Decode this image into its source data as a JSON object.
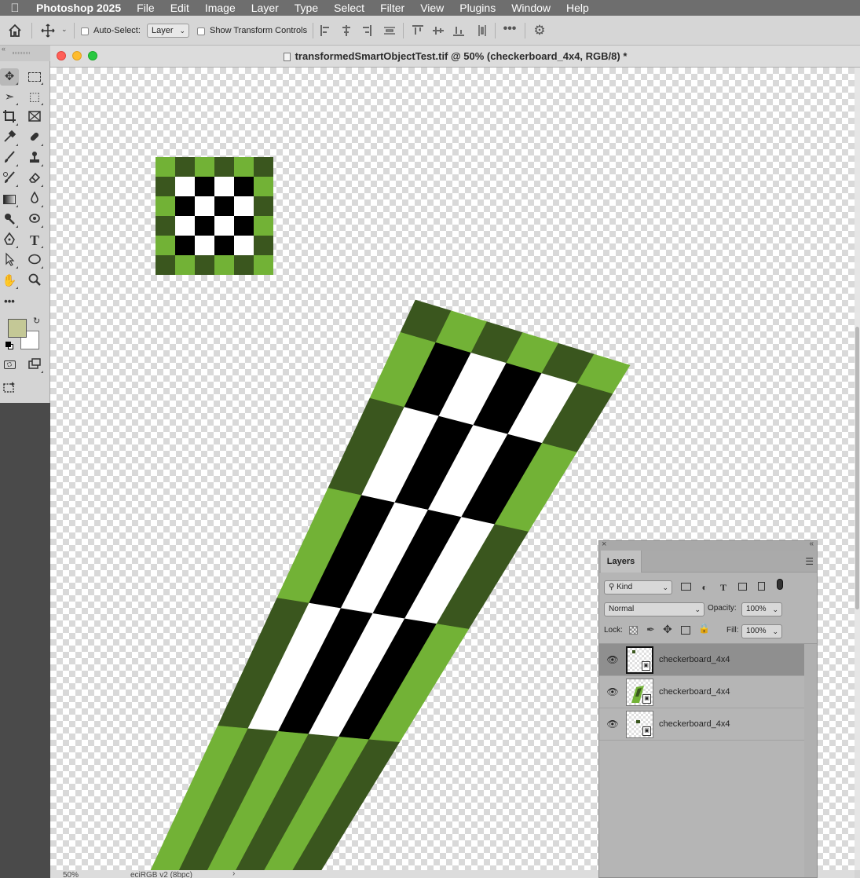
{
  "menubar": {
    "app_name": "Photoshop 2025",
    "items": [
      "File",
      "Edit",
      "Image",
      "Layer",
      "Type",
      "Select",
      "Filter",
      "View",
      "Plugins",
      "Window",
      "Help"
    ]
  },
  "options_bar": {
    "auto_select_label": "Auto-Select:",
    "auto_select_target": "Layer",
    "show_transform_label": "Show Transform Controls"
  },
  "document": {
    "title": "transformedSmartObjectTest.tif @ 50% (checkerboard_4x4, RGB/8) *",
    "zoom": "50%",
    "color_profile": "eciRGB v2 (8bpc)"
  },
  "toolbox": {
    "foreground_color": "#c4c896",
    "background_color": "#ffffff"
  },
  "layers_panel": {
    "tab_label": "Layers",
    "kind_filter": "Kind",
    "blend_mode": "Normal",
    "opacity_label": "Opacity:",
    "opacity": "100%",
    "lock_label": "Lock:",
    "fill_label": "Fill:",
    "fill": "100%",
    "layers": [
      {
        "name": "checkerboard_4x4",
        "visible": true,
        "selected": true
      },
      {
        "name": "checkerboard_4x4",
        "visible": true,
        "selected": false
      },
      {
        "name": "checkerboard_4x4",
        "visible": true,
        "selected": false
      }
    ]
  },
  "colors": {
    "light_green": "#72b236",
    "dark_green": "#3a561e",
    "black": "#000000",
    "white": "#ffffff"
  }
}
